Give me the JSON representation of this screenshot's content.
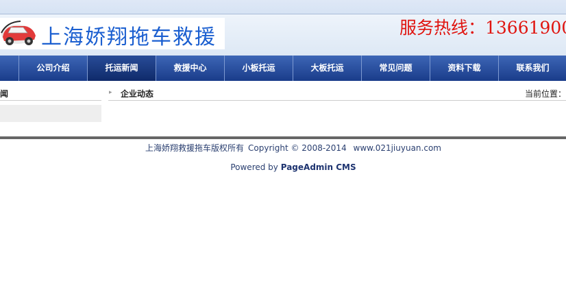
{
  "header": {
    "logo_text": "上海娇翔拖车救援",
    "hotline": "服务热线：13661900"
  },
  "nav": {
    "items": [
      {
        "label": "公司介绍"
      },
      {
        "label": "托运新闻"
      },
      {
        "label": "救援中心"
      },
      {
        "label": "小板托运"
      },
      {
        "label": "大板托运"
      },
      {
        "label": "常见问题"
      },
      {
        "label": "资料下载"
      },
      {
        "label": "联系我们"
      }
    ],
    "active_index": 1
  },
  "sidebar": {
    "title": "闻"
  },
  "main": {
    "title": "企业动态",
    "location_label": "当前位置："
  },
  "footer": {
    "copyright_owner": "上海娇翔救援拖车版权所有",
    "copyright": "Copyright © 2008-2014",
    "site": "www.021jiuyuan.com",
    "powered_prefix": "Powered by",
    "powered_brand": "PageAdmin CMS"
  },
  "colors": {
    "nav_bg": "#1f4391",
    "hotline": "#e0140f",
    "logo_text": "#1b5fd0",
    "footer_text": "#2a3f70"
  }
}
